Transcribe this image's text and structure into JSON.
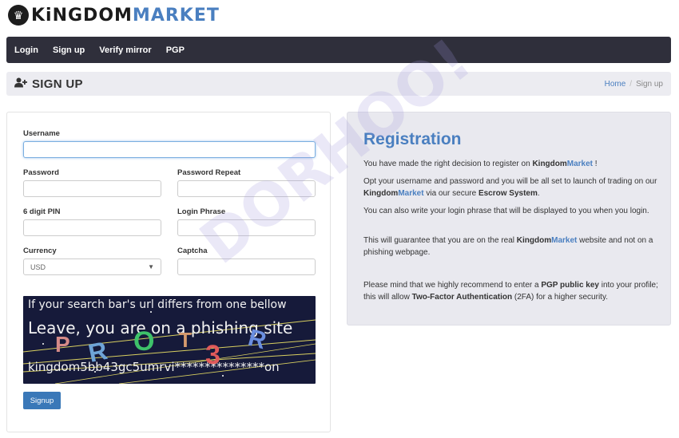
{
  "logo": {
    "part1": "KiNGDOM",
    "part2": "MARKET"
  },
  "nav": {
    "items": [
      "Login",
      "Sign up",
      "Verify mirror",
      "PGP"
    ]
  },
  "page": {
    "title": "SIGN UP",
    "breadcrumb_home": "Home",
    "breadcrumb_current": "Sign up"
  },
  "form": {
    "username_label": "Username",
    "password_label": "Password",
    "password_repeat_label": "Password Repeat",
    "pin_label": "6 digit PIN",
    "login_phrase_label": "Login Phrase",
    "currency_label": "Currency",
    "currency_value": "USD",
    "captcha_label": "Captcha",
    "captcha_line1": "If your search bar's url differs from one bellow",
    "captcha_line2": "Leave, you are on a phishing site",
    "captcha_line3": "kingdom5bb43gc5umrvi***************on",
    "captcha_chars": [
      "P",
      "R",
      "O",
      "T",
      "3",
      "R"
    ],
    "submit_label": "Signup"
  },
  "registration": {
    "title": "Registration",
    "p1_a": "You have made the right decision to register on ",
    "brand_a": "Kingdom",
    "brand_b": "Market",
    "p1_b": " !",
    "p2_a": "Opt your username and password and you will be all set to launch of trading on our ",
    "p2_b": " via our secure ",
    "p2_escrow": "Escrow System",
    "p2_c": ".",
    "p3": "You can also write your login phrase that will be displayed to you when you login.",
    "p4_a": "This will guarantee that you are on the real ",
    "p4_b": " website and not on a phishing webpage.",
    "p5_a": "Please mind that we highly recommend to enter a ",
    "p5_pgp": "PGP public key",
    "p5_b": " into your profile; this will allow ",
    "p5_2fa": "Two-Factor Authentication",
    "p5_c": " (2FA) for a higher security."
  },
  "watermark": "DORHOO!",
  "colors": {
    "accent": "#4a7fc0",
    "navbar": "#2f2f3b",
    "button": "#3a78b8"
  }
}
